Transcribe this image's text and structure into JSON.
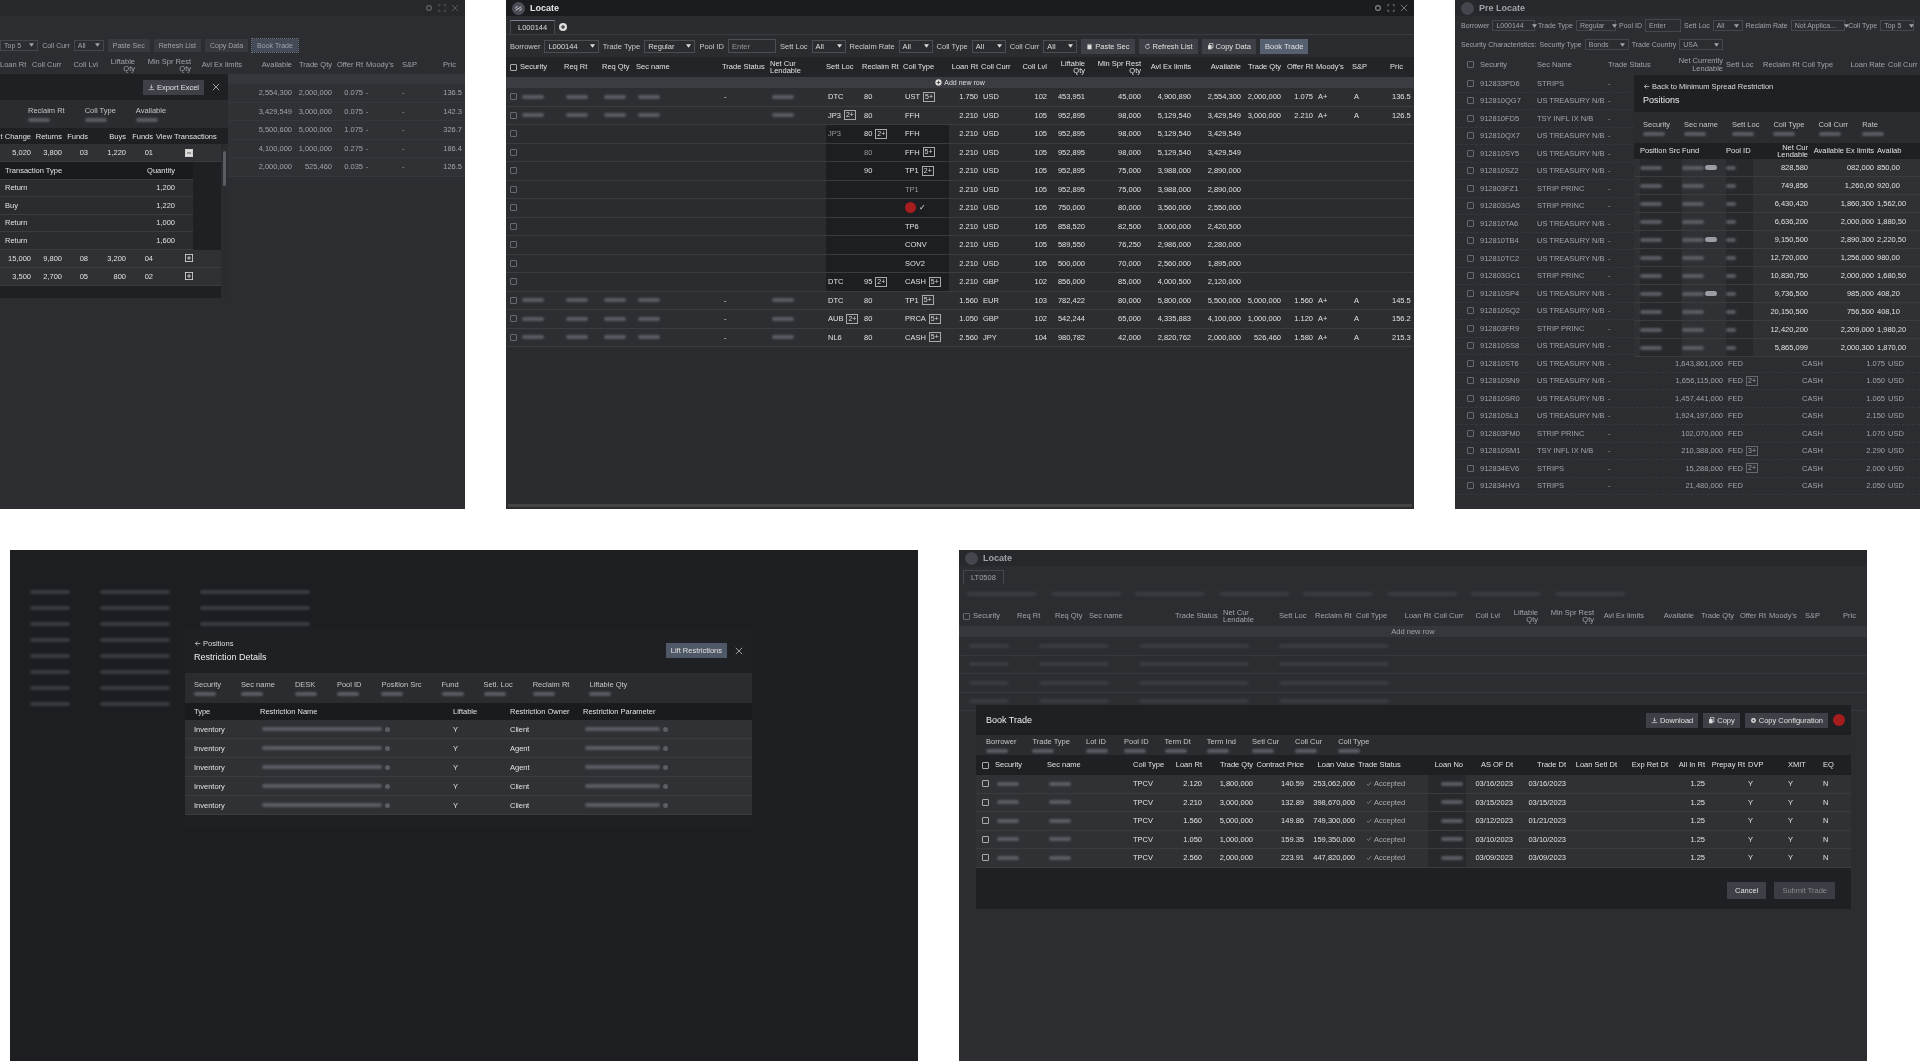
{
  "export_view": {
    "toolbar": [
      {
        "kind": "select",
        "text": "Top 5"
      },
      {
        "kind": "label",
        "text": "Coll Curr"
      },
      {
        "kind": "select",
        "text": "All"
      },
      {
        "kind": "button",
        "text": "Paste Sec"
      },
      {
        "kind": "button",
        "text": "Refresh List"
      },
      {
        "kind": "button",
        "text": "Copy Data"
      },
      {
        "kind": "primary",
        "text": "Book Trade"
      }
    ],
    "columns": [
      "Loan Rt",
      "Coll Curr",
      "Coll Lvl",
      "Liftable Qty",
      "Min Spr Rest Qty",
      "Avl Ex limits",
      "Available",
      "Trade Qty",
      "Offer Rt",
      "Moody's",
      "S&P",
      "Pric"
    ],
    "rows": [
      [
        "2,554,300",
        "2,000,000",
        "0.075",
        "-",
        "-",
        "136.5"
      ],
      [
        "3,429,549",
        "3,000,000",
        "0.075",
        "-",
        "-",
        "142.3"
      ],
      [
        "5,500,600",
        "5,000,000",
        "1.075",
        "-",
        "-",
        "326.7"
      ],
      [
        "4,100,000",
        "1,000,000",
        "0.275",
        "-",
        "-",
        "186.4"
      ],
      [
        "2,000,000",
        "525,460",
        "0.035",
        "-",
        "-",
        "126.5"
      ]
    ],
    "popup": {
      "export_button": "Export Excel",
      "summary": [
        "Reclaim Rt",
        "Coll Type",
        "Available"
      ],
      "columns": [
        "t Change",
        "Returns",
        "Funds",
        "Buys",
        "Funds",
        "View Transactions"
      ],
      "rows": [
        {
          "cells": [
            "5,020",
            "3,800",
            "03",
            "1,220",
            "01"
          ],
          "expanded": true,
          "transactions": {
            "columns": [
              "Transaction Type",
              "Quantity"
            ],
            "rows": [
              [
                "Return",
                "1,200"
              ],
              [
                "Buy",
                "1,220"
              ],
              [
                "Return",
                "1,000"
              ],
              [
                "Return",
                "1,600"
              ]
            ]
          }
        },
        {
          "cells": [
            "15,000",
            "9,800",
            "08",
            "3,200",
            "04"
          ],
          "expanded": false
        },
        {
          "cells": [
            "3,500",
            "2,700",
            "05",
            "800",
            "02"
          ],
          "expanded": false
        }
      ]
    }
  },
  "locate": {
    "title": "Locate",
    "tabs": [
      {
        "label": "L000144",
        "selected": true
      }
    ],
    "filters": [
      {
        "label": "Borrower",
        "value": "L000144"
      },
      {
        "label": "Trade Type",
        "value": "Regular"
      },
      {
        "label": "Pool ID",
        "placeholder": "Enter"
      },
      {
        "label": "Sett Loc",
        "value": "All"
      },
      {
        "label": "Reclaim Rate",
        "value": "All"
      },
      {
        "label": "Coll Type",
        "value": "All"
      },
      {
        "label": "Coll Curr",
        "value": "All"
      }
    ],
    "buttons": [
      {
        "kind": "paste",
        "text": "Paste Sec"
      },
      {
        "kind": "refresh",
        "text": "Refresh List"
      },
      {
        "kind": "copy",
        "text": "Copy Data"
      },
      {
        "kind": "primary",
        "text": "Book Trade"
      }
    ],
    "all_checked": false,
    "columns": [
      "Security",
      "Req Rt",
      "Req Qty",
      "Sec name",
      "Trade Status",
      "Net Cur Lendable",
      "Sett Loc",
      "Reclaim Rt",
      "Coll Type",
      "Loan Rt",
      "Coll Curr",
      "Coll Lvl",
      "Liftable Qty",
      "Min Spr Rest Qty",
      "Avl Ex limits",
      "Available",
      "Trade Qty",
      "Offer Rt",
      "Moody's",
      "S&P",
      "Pric"
    ],
    "add_row": "Add new row",
    "rows": [
      {
        "checked": false,
        "nested": false,
        "cells": [
          {
            "blur": true
          },
          {
            "blur": true
          },
          {
            "blur": true
          },
          {
            "blur": true
          },
          "-",
          {
            "blur": true
          },
          "DTC",
          "80",
          {
            "text": "UST",
            "badge": "5+"
          },
          "1.750",
          "USD",
          "102",
          "453,951",
          "45,000",
          "4,900,890",
          "2,554,300",
          "2,000,000",
          "1.075",
          "A+",
          "A",
          "136.5"
        ]
      },
      {
        "checked": false,
        "nested": false,
        "cells": [
          {
            "blur": true
          },
          {
            "blur": true
          },
          {
            "blur": true
          },
          {
            "blur": true
          },
          null,
          {
            "blur": true
          },
          {
            "text": "JP3",
            "badge": "2+"
          },
          "80",
          "FFH",
          "2.210",
          "USD",
          "105",
          "952,895",
          "98,000",
          "5,129,540",
          "3,429,549",
          "3,000,000",
          "2.210",
          "A+",
          "A",
          "126.5"
        ]
      },
      {
        "checked": false,
        "nested": true,
        "cells": [
          null,
          null,
          null,
          null,
          null,
          null,
          {
            "text": "JP3",
            "dim": true
          },
          {
            "text": "80",
            "badge": "2+"
          },
          "FFH",
          "2.210",
          "USD",
          "105",
          "952,895",
          "98,000",
          "5,129,540",
          "3,429,549",
          null,
          null,
          null,
          null,
          null
        ]
      },
      {
        "checked": false,
        "nested": true,
        "cells": [
          null,
          null,
          null,
          null,
          null,
          null,
          null,
          {
            "text": "80",
            "dim": true
          },
          {
            "text": "FFH",
            "badge": "5+"
          },
          "2.210",
          "USD",
          "105",
          "952,895",
          "98,000",
          "5,129,540",
          "3,429,549",
          null,
          null,
          null,
          null,
          null
        ]
      },
      {
        "checked": false,
        "nested": true,
        "cells": [
          null,
          null,
          null,
          null,
          null,
          null,
          null,
          "90",
          {
            "text": "TP1",
            "badge": "2+"
          },
          "2.210",
          "USD",
          "105",
          "952,895",
          "75,000",
          "3,988,000",
          "2,890,000",
          null,
          null,
          null,
          null,
          null
        ]
      },
      {
        "checked": false,
        "nested": true,
        "cells": [
          null,
          null,
          null,
          null,
          null,
          null,
          null,
          null,
          {
            "text": "TP1",
            "dim": true
          },
          "2.210",
          "USD",
          "105",
          "952,895",
          "75,000",
          "3,988,000",
          "2,890,000",
          null,
          null,
          null,
          null,
          null
        ]
      },
      {
        "checked": false,
        "nested": true,
        "cells": [
          null,
          null,
          null,
          null,
          null,
          null,
          null,
          null,
          {
            "color": "#a51d1d",
            "text": "✓"
          },
          "2.210",
          "USD",
          "105",
          "750,000",
          "80,000",
          "3,560,000",
          "2,550,000",
          null,
          null,
          null,
          null,
          null
        ]
      },
      {
        "checked": false,
        "nested": true,
        "cells": [
          null,
          null,
          null,
          null,
          null,
          null,
          null,
          null,
          "TP6",
          "2.210",
          "USD",
          "105",
          "858,520",
          "82,500",
          "3,000,000",
          "2,420,500",
          null,
          null,
          null,
          null,
          null
        ]
      },
      {
        "checked": false,
        "nested": true,
        "cells": [
          null,
          null,
          null,
          null,
          null,
          null,
          null,
          null,
          "CONV",
          "2.210",
          "USD",
          "105",
          "589,550",
          "76,250",
          "2,986,000",
          "2,280,000",
          null,
          null,
          null,
          null,
          null
        ]
      },
      {
        "checked": false,
        "nested": true,
        "cells": [
          null,
          null,
          null,
          null,
          null,
          null,
          null,
          null,
          "SOV2",
          "2.210",
          "USD",
          "105",
          "500,000",
          "70,000",
          "2,560,000",
          "1,895,000",
          null,
          null,
          null,
          null,
          null
        ]
      },
      {
        "checked": false,
        "nested": true,
        "cells": [
          null,
          null,
          null,
          null,
          null,
          null,
          "DTC",
          {
            "text": "95",
            "badge": "2+"
          },
          {
            "text": "CASH",
            "badge": "5+"
          },
          "2.210",
          "GBP",
          "102",
          "856,000",
          "85,000",
          "4,000,500",
          "2,120,000",
          null,
          null,
          null,
          null,
          null
        ]
      },
      {
        "checked": false,
        "nested": false,
        "cells": [
          {
            "blur": true
          },
          {
            "blur": true
          },
          {
            "blur": true
          },
          {
            "blur": true
          },
          "-",
          {
            "blur": true
          },
          "DTC",
          "80",
          {
            "text": "TP1",
            "badge": "5+"
          },
          "1.560",
          "EUR",
          "103",
          "782,422",
          "80,000",
          "5,800,000",
          "5,500,000",
          "5,000,000",
          "1.560",
          "A+",
          "A",
          "145.5"
        ]
      },
      {
        "checked": false,
        "nested": false,
        "cells": [
          {
            "blur": true
          },
          {
            "blur": true
          },
          {
            "blur": true
          },
          {
            "blur": true
          },
          "-",
          {
            "blur": true
          },
          {
            "text": "AUB",
            "badge": "2+"
          },
          "80",
          {
            "text": "PRCA",
            "badge": "5+"
          },
          "1.050",
          "GBP",
          "102",
          "542,244",
          "65,000",
          "4,335,883",
          "4,100,000",
          "1,000,000",
          "1.120",
          "A+",
          "A",
          "156.2"
        ]
      },
      {
        "checked": false,
        "nested": false,
        "cells": [
          {
            "blur": true
          },
          {
            "blur": true
          },
          {
            "blur": true
          },
          {
            "blur": true
          },
          "-",
          {
            "blur": true
          },
          "NL6",
          "80",
          {
            "text": "CASH",
            "badge": "5+"
          },
          "2.560",
          "JPY",
          "104",
          "980,782",
          "42,000",
          "2,820,762",
          "2,000,000",
          "526,460",
          "1.580",
          "A+",
          "A",
          "215.3"
        ]
      }
    ]
  },
  "pre_locate": {
    "title": "Pre Locate",
    "filters": [
      {
        "label": "Borrower",
        "value": "L000144"
      },
      {
        "label": "Trade Type",
        "value": "Regular"
      },
      {
        "label": "Pool ID",
        "placeholder": "Enter"
      },
      {
        "label": "Sett Loc",
        "value": "All"
      },
      {
        "label": "Reclaim Rate",
        "value": "Not Applica..."
      },
      {
        "label": "Coll Type",
        "value": "Top 5"
      }
    ],
    "characteristics": {
      "label": "Security Characteristics:",
      "filters": [
        {
          "label": "Security Type",
          "value": "Bonds"
        },
        {
          "label": "Trade Country",
          "value": "USA"
        }
      ]
    },
    "all_checked": false,
    "columns": [
      "Security",
      "Sec Name",
      "Trade Status",
      "Net Currently Lendable",
      "Sett Loc",
      "Reclaim Rt",
      "Coll Type",
      "Loan Rate",
      "Coll Curr"
    ],
    "rows": [
      {
        "checked": false,
        "security": "912833PD6",
        "sec_name": "STRIPS",
        "trade_status": "-"
      },
      {
        "checked": false,
        "security": "912810QG7",
        "sec_name": "US TREASURY N/B",
        "trade_status": "-"
      },
      {
        "checked": false,
        "security": "912810FD5",
        "sec_name": "TSY INFL IX N/B",
        "trade_status": "-"
      },
      {
        "checked": false,
        "security": "912810QX7",
        "sec_name": "US TREASURY N/B",
        "trade_status": "-"
      },
      {
        "checked": false,
        "security": "912810SY5",
        "sec_name": "US TREASURY N/B",
        "trade_status": "-"
      },
      {
        "checked": false,
        "security": "912810SZ2",
        "sec_name": "US TREASURY N/B",
        "trade_status": "-"
      },
      {
        "checked": false,
        "security": "912803FZ1",
        "sec_name": "STRIP PRINC",
        "trade_status": "-"
      },
      {
        "checked": false,
        "security": "912803GA5",
        "sec_name": "STRIP PRINC",
        "trade_status": "-"
      },
      {
        "checked": false,
        "security": "912810TA6",
        "sec_name": "US TREASURY N/B",
        "trade_status": "-"
      },
      {
        "checked": false,
        "security": "912810TB4",
        "sec_name": "US TREASURY N/B",
        "trade_status": "-"
      },
      {
        "checked": false,
        "security": "912810TC2",
        "sec_name": "US TREASURY N/B",
        "trade_status": "-"
      },
      {
        "checked": false,
        "security": "912803GC1",
        "sec_name": "STRIP PRINC",
        "trade_status": "-"
      },
      {
        "checked": false,
        "security": "912810SP4",
        "sec_name": "US TREASURY N/B",
        "trade_status": "-"
      },
      {
        "checked": false,
        "security": "912810SQ2",
        "sec_name": "US TREASURY N/B",
        "trade_status": "-"
      },
      {
        "checked": false,
        "security": "912803FR9",
        "sec_name": "STRIP PRINC",
        "trade_status": "-"
      },
      {
        "checked": false,
        "security": "912810SS8",
        "sec_name": "US TREASURY N/B",
        "trade_status": "-"
      },
      {
        "checked": false,
        "security": "912810ST6",
        "sec_name": "US TREASURY N/B",
        "trade_status": "-",
        "net_lendable": "1,643,861,000",
        "sett_loc": "FED",
        "coll_type": "CASH",
        "loan_rate": "1.075",
        "coll_curr": "USD"
      },
      {
        "checked": false,
        "security": "912810SN9",
        "sec_name": "US TREASURY N/B",
        "trade_status": "-",
        "net_lendable": "1,656,115,000",
        "sett_loc": "FED",
        "sett_badge": "2+",
        "coll_type": "CASH",
        "loan_rate": "1.050",
        "coll_curr": "USD"
      },
      {
        "checked": false,
        "security": "912810SR0",
        "sec_name": "US TREASURY N/B",
        "trade_status": "-",
        "net_lendable": "1,457,441,000",
        "sett_loc": "FED",
        "coll_type": "CASH",
        "loan_rate": "1.065",
        "coll_curr": "USD"
      },
      {
        "checked": false,
        "security": "912810SL3",
        "sec_name": "US TREASURY N/B",
        "trade_status": "-",
        "net_lendable": "1,924,197,000",
        "sett_loc": "FED",
        "coll_type": "CASH",
        "loan_rate": "2.150",
        "coll_curr": "USD"
      },
      {
        "checked": false,
        "security": "912803FM0",
        "sec_name": "STRIP PRINC",
        "trade_status": "-",
        "net_lendable": "102,070,000",
        "sett_loc": "FED",
        "coll_type": "CASH",
        "loan_rate": "1.070",
        "coll_curr": "USD"
      },
      {
        "checked": false,
        "security": "912810SM1",
        "sec_name": "TSY INFL IX N/B",
        "trade_status": "-",
        "net_lendable": "210,388,000",
        "sett_loc": "FED",
        "sett_badge": "3+",
        "coll_type": "CASH",
        "loan_rate": "2.290",
        "coll_curr": "USD"
      },
      {
        "checked": false,
        "security": "912834EV6",
        "sec_name": "STRIPS",
        "trade_status": "-",
        "net_lendable": "15,288,000",
        "sett_loc": "FED",
        "sett_badge": "2+",
        "coll_type": "CASH",
        "loan_rate": "2.000",
        "coll_curr": "USD"
      },
      {
        "checked": false,
        "security": "912834HV3",
        "sec_name": "STRIPS",
        "trade_status": "-",
        "net_lendable": "21,480,000",
        "sett_loc": "FED",
        "coll_type": "CASH",
        "loan_rate": "2.050",
        "coll_curr": "USD"
      }
    ],
    "popup": {
      "back_link": "Back to Minimum Spread Restriction",
      "title": "Positions",
      "summary": [
        "Security",
        "Sec name",
        "Sett Loc",
        "Coll Type",
        "Coll Curr",
        "Rate"
      ],
      "columns": [
        "Position Src",
        "Fund",
        "Pool ID",
        "Net Cur Lendable",
        "Available Ex limits",
        "Availab"
      ],
      "rows": [
        {
          "tag": true,
          "net_lendable": "828,580",
          "available_ex": "082,000",
          "available": "850,00"
        },
        {
          "tag": false,
          "net_lendable": "749,856",
          "available_ex": "1,260,00",
          "available": "920,00"
        },
        {
          "tag": false,
          "net_lendable": "6,430,420",
          "available_ex": "1,860,300",
          "available": "1,562,00"
        },
        {
          "tag": false,
          "net_lendable": "6,636,200",
          "available_ex": "2,000,000",
          "available": "1,880,50"
        },
        {
          "tag": true,
          "net_lendable": "9,150,500",
          "available_ex": "2,890,300",
          "available": "2,220,50"
        },
        {
          "tag": false,
          "net_lendable": "12,720,000",
          "available_ex": "1,256,000",
          "available": "980,00"
        },
        {
          "tag": false,
          "net_lendable": "10,830,750",
          "available_ex": "2,000,000",
          "available": "1,680,50"
        },
        {
          "tag": true,
          "net_lendable": "9,736,500",
          "available_ex": "985,000",
          "available": "408,20"
        },
        {
          "tag": false,
          "net_lendable": "20,150,500",
          "available_ex": "756,500",
          "available": "408,10"
        },
        {
          "tag": false,
          "net_lendable": "12,420,200",
          "available_ex": "2,209,000",
          "available": "1,980,20"
        },
        {
          "tag": false,
          "net_lendable": "5,865,099",
          "available_ex": "2,000,300",
          "available": "1,870,00"
        }
      ]
    }
  },
  "restriction_details": {
    "back_link": "Positions",
    "title": "Restriction Details",
    "lift_button": "Lift Restrictions",
    "summary": [
      "Security",
      "Sec name",
      "DESK",
      "Pool ID",
      "Position Src",
      "Fund",
      "Setl. Loc",
      "Reclaim Rt",
      "Liftable Qty"
    ],
    "columns": [
      "Type",
      "Restriction Name",
      "Liftable",
      "Restriction Owner",
      "Restriction Parameter"
    ],
    "rows": [
      {
        "type": "Inventory",
        "liftable": "Y",
        "owner": "Client"
      },
      {
        "type": "Inventory",
        "liftable": "Y",
        "owner": "Agent"
      },
      {
        "type": "Inventory",
        "liftable": "Y",
        "owner": "Agent"
      },
      {
        "type": "Inventory",
        "liftable": "Y",
        "owner": "Client"
      },
      {
        "type": "Inventory",
        "liftable": "Y",
        "owner": "Client"
      }
    ]
  },
  "book_trade": {
    "background": {
      "title": "Locate",
      "tab": "LT0508",
      "all_checked": false,
      "columns": [
        "Security",
        "Req Rt",
        "Req Qty",
        "Sec name",
        "Trade Status",
        "Net Cur Lendable",
        "Sett Loc",
        "Reclaim Rt",
        "Coll Type",
        "Loan Rt",
        "Coll Curr",
        "Coll Lvl",
        "Liftable Qty",
        "Min Spr Rest Qty",
        "Avl Ex limits",
        "Available",
        "Trade Qty",
        "Offer Rt",
        "Moody's",
        "S&P",
        "Pric"
      ],
      "add_row": "Add new row"
    },
    "title": "Book Trade",
    "buttons": [
      {
        "kind": "download",
        "text": "Download"
      },
      {
        "kind": "copy",
        "text": "Copy"
      },
      {
        "kind": "config",
        "text": "Copy Configuration"
      }
    ],
    "summary": [
      "Borrower",
      "Trade Type",
      "Lot ID",
      "Pool ID",
      "Term Dt",
      "Term Ind",
      "Setl Cur",
      "Coll Cur",
      "Coll Type"
    ],
    "all_checked": false,
    "columns": [
      "Security",
      "Sec name",
      "Coll  Type",
      "Loan Rt",
      "Trade Qty",
      "Contract Price",
      "Loan Value",
      "Trade Status",
      "Loan No",
      "AS OF Dt",
      "Trade Dt",
      "Loan Setl Dt",
      "Exp Ret Dt",
      "All In Rt",
      "Prepay Rt",
      "DVP",
      "XMIT",
      "EQ"
    ],
    "rows": [
      {
        "checked": false,
        "coll_type": "TPCV",
        "loan_rt": "2.120",
        "trade_qty": "1,800,000",
        "contract_price": "140.59",
        "loan_value": "253,062,000",
        "trade_status": "Accepted",
        "as_of_dt": "03/16/2023",
        "trade_dt": "03/16/2023",
        "all_in_rt": "1.25",
        "dvp": "Y",
        "xmit": "Y",
        "eq": "N"
      },
      {
        "checked": false,
        "coll_type": "TPCV",
        "loan_rt": "2.210",
        "trade_qty": "3,000,000",
        "contract_price": "132.89",
        "loan_value": "398,670,000",
        "trade_status": "Accepted",
        "as_of_dt": "03/15/2023",
        "trade_dt": "03/15/2023",
        "all_in_rt": "1.25",
        "dvp": "Y",
        "xmit": "Y",
        "eq": "N"
      },
      {
        "checked": false,
        "coll_type": "TPCV",
        "loan_rt": "1.560",
        "trade_qty": "5,000,000",
        "contract_price": "149.86",
        "loan_value": "749,300,000",
        "trade_status": "Accepted",
        "as_of_dt": "03/12/2023",
        "trade_dt": "01/21/2023",
        "all_in_rt": "1.25",
        "dvp": "Y",
        "xmit": "Y",
        "eq": "N"
      },
      {
        "checked": false,
        "coll_type": "TPCV",
        "loan_rt": "1.050",
        "trade_qty": "1,000,000",
        "contract_price": "159.35",
        "loan_value": "159,350,000",
        "trade_status": "Accepted",
        "as_of_dt": "03/10/2023",
        "trade_dt": "03/10/2023",
        "all_in_rt": "1.25",
        "dvp": "Y",
        "xmit": "Y",
        "eq": "N"
      },
      {
        "checked": false,
        "coll_type": "TPCV",
        "loan_rt": "2.560",
        "trade_qty": "2,000,000",
        "contract_price": "223.91",
        "loan_value": "447,820,000",
        "trade_status": "Accepted",
        "as_of_dt": "03/09/2023",
        "trade_dt": "03/09/2023",
        "all_in_rt": "1.25",
        "dvp": "Y",
        "xmit": "Y",
        "eq": "N"
      }
    ],
    "footer": [
      {
        "kind": "secondary",
        "text": "Cancel",
        "disabled": false
      },
      {
        "kind": "primary",
        "text": "Submit Trade",
        "disabled": true
      }
    ]
  }
}
